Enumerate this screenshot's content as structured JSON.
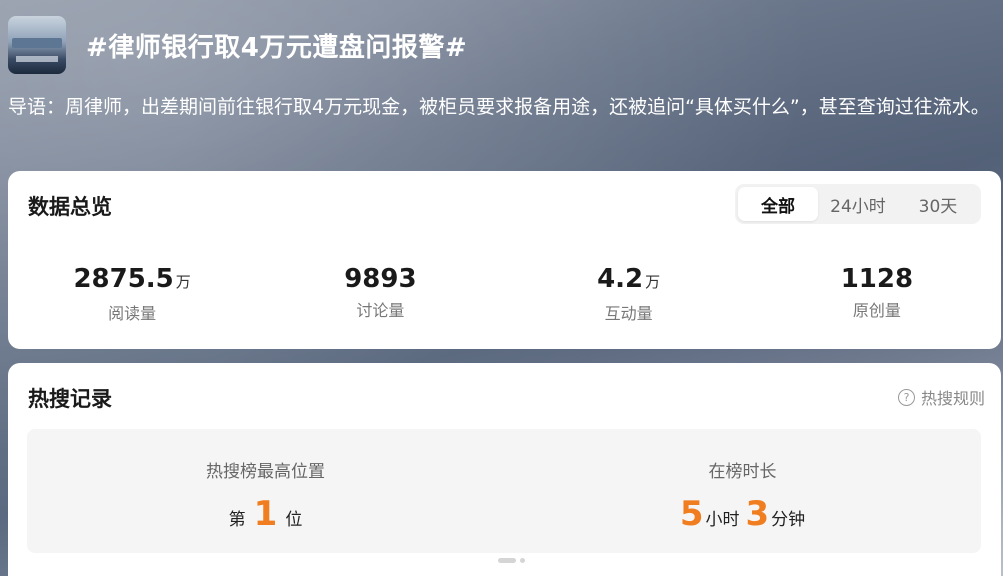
{
  "header": {
    "title": "#律师银行取4万元遭盘问报警#",
    "thumbnail_icon": "news-thumbnail"
  },
  "lead": {
    "text": "导语：周律师，出差期间前往银行取4万元现金，被柜员要求报备用途，还被追问“具体买什么”，甚至查询过往流水。"
  },
  "overview": {
    "title": "数据总览",
    "tabs": [
      {
        "label": "全部",
        "active": true
      },
      {
        "label": "24小时",
        "active": false
      },
      {
        "label": "30天",
        "active": false
      }
    ],
    "stats": [
      {
        "value": "2875.5",
        "unit": "万",
        "label": "阅读量"
      },
      {
        "value": "9893",
        "unit": "",
        "label": "讨论量"
      },
      {
        "value": "4.2",
        "unit": "万",
        "label": "互动量"
      },
      {
        "value": "1128",
        "unit": "",
        "label": "原创量"
      }
    ]
  },
  "hot": {
    "title": "热搜记录",
    "rules_label": "热搜规则",
    "rules_icon": "question-circle-icon",
    "best_rank_label": "热搜榜最高位置",
    "rank_prefix": "第",
    "rank_value": "1",
    "rank_suffix": "位",
    "duration_label": "在榜时长",
    "hours_value": "5",
    "hours_unit": "小时",
    "minutes_value": "3",
    "minutes_unit": "分钟",
    "accent_color": "#f07d1f"
  }
}
